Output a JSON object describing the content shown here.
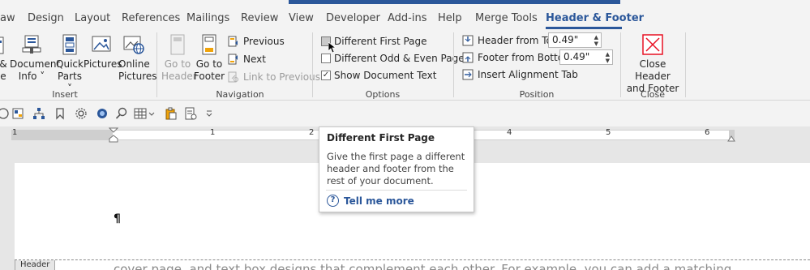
{
  "tabs": [
    "aw",
    "Design",
    "Layout",
    "References",
    "Mailings",
    "Review",
    "View",
    "Developer",
    "Add-ins",
    "Help",
    "Merge Tools",
    "Header & Footer"
  ],
  "ribbon": {
    "insert": {
      "partial_label_1": "&",
      "partial_label_2": "e",
      "document_info": [
        "Document",
        "Info ˅"
      ],
      "quick_parts": [
        "Quick",
        "Parts ˅"
      ],
      "pictures": "Pictures",
      "online_pictures": [
        "Online",
        "Pictures"
      ],
      "group_label": "Insert"
    },
    "navigation": {
      "go_to_header": [
        "Go to",
        "Header"
      ],
      "go_to_footer": [
        "Go to",
        "Footer"
      ],
      "previous": "Previous",
      "next": "Next",
      "link_to_previous": "Link to Previous",
      "group_label": "Navigation"
    },
    "options": {
      "different_first_page": "Different First Page",
      "different_odd_even": "Different Odd & Even Pages",
      "show_document_text": "Show Document Text",
      "group_label": "Options"
    },
    "position": {
      "header_from_top_label": "Header from Top:",
      "header_from_top_value": "0.49\"",
      "footer_from_bottom_label": "Footer from Bottom:",
      "footer_from_bottom_value": "0.49\"",
      "insert_alignment_tab": "Insert Alignment Tab",
      "group_label": "Position"
    },
    "close": {
      "close_header_footer": [
        "Close Header",
        "and Footer"
      ],
      "group_label": "Close"
    }
  },
  "ruler": {
    "numbers": [
      "1",
      "1",
      "2",
      "4",
      "5",
      "6"
    ]
  },
  "tooltip": {
    "title": "Different First Page",
    "description": "Give the first page a different header and footer from the rest of your document.",
    "link": "Tell me more"
  },
  "document": {
    "header_tag": "Header",
    "body_text": "cover page, and text box designs that complement each other. For example, you can add a matching",
    "pilcrow": "¶"
  },
  "colors": {
    "accent": "#2b579a",
    "close_red": "#e81123"
  }
}
